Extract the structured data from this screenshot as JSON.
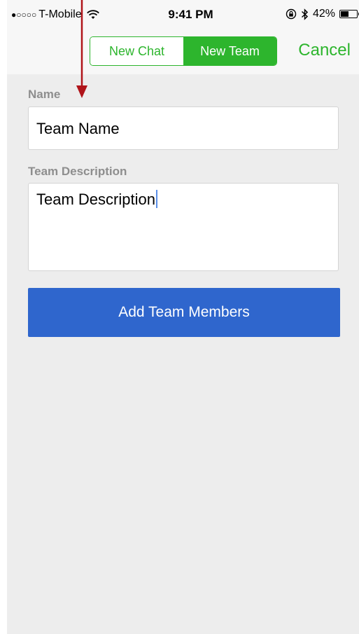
{
  "status_bar": {
    "signal": "●○○○○",
    "carrier": "T-Mobile",
    "time": "9:41 PM",
    "battery_percent": "42%",
    "icons": [
      "wifi-icon",
      "rotation-lock-icon",
      "bluetooth-icon",
      "battery-icon"
    ]
  },
  "nav": {
    "segments": [
      {
        "label": "New Chat",
        "selected": false
      },
      {
        "label": "New Team",
        "selected": true
      }
    ],
    "cancel_label": "Cancel",
    "accent_color": "#2db52d"
  },
  "form": {
    "name_label": "Name",
    "name_value": "Team Name",
    "description_label": "Team Description",
    "description_value": "Team Description",
    "add_members_label": "Add Team Members",
    "button_color": "#2f66cd"
  },
  "annotation": {
    "arrow_color": "#b0141a"
  }
}
